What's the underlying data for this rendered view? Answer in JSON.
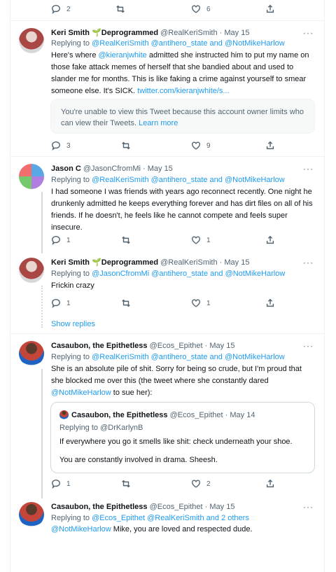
{
  "top_actions": {
    "reply": "2",
    "retweet": "",
    "like": "6"
  },
  "tweets": [
    {
      "name": "Keri Smith",
      "badge": "Deprogrammed",
      "handle": "@RealKeriSmith",
      "sep": " · ",
      "date": "May 15",
      "replying_prefix": "Replying to ",
      "replying_to": "@RealKeriSmith @antihero_state and @NotMikeHarlow",
      "body_1": "Here's where ",
      "body_mention": "@kieranjwhite",
      "body_2": " admitted she instructed him to put my name on those fake attack memes of herself that she bandied about and used to slander me for months. This is like faking a crime against yourself to smear someone else. It's SICK. ",
      "body_link": "twitter.com/kieranjwhite/s...",
      "card_text": "You're unable to view this Tweet because this account owner limits who can view their Tweets. ",
      "card_link": "Learn more",
      "reply_count": "3",
      "like_count": "9"
    },
    {
      "name": "Jason C",
      "handle": "@JasonCfromMi",
      "sep": " · ",
      "date": "May 15",
      "replying_prefix": "Replying to ",
      "replying_to": "@RealKeriSmith @antihero_state and @NotMikeHarlow",
      "body": "I had someone I was friends with years ago reconnect recently. One night he drunkenly admitted he keeps everything forever and has dirt files on all of his friends. If he doesn't, he feels like he cannot compete and feels super insecure.",
      "reply_count": "1",
      "like_count": "1"
    },
    {
      "name": "Keri Smith",
      "badge": "Deprogrammed",
      "handle": "@RealKeriSmith",
      "sep": " · ",
      "date": "May 15",
      "replying_prefix": "Replying to ",
      "replying_to": "@JasonCfromMi @antihero_state and @NotMikeHarlow",
      "body": "Frickin crazy",
      "reply_count": "1",
      "like_count": "1"
    },
    {
      "name": "Casaubon, the Epithetless",
      "handle": "@Ecos_Epithet",
      "sep": " · ",
      "date": "May 15",
      "replying_prefix": "Replying to ",
      "replying_to": "@RealKeriSmith @antihero_state and @NotMikeHarlow",
      "body_1": "She is an absolute pile of shit. Sorry for being so crude, but I'm proud that she blocked me over this (the tweet where she constantly dared ",
      "body_mention": "@NotMikeHarlow",
      "body_2": " to sue her):",
      "quote": {
        "name": "Casaubon, the Epithetless",
        "handle": "@Ecos_Epithet",
        "sep": " · ",
        "date": "May 14",
        "replying_prefix": "Replying to ",
        "replying_to": "@DrKarlynB",
        "line1": "If everywhere you go it smells like shit: check underneath your shoe.",
        "line2": "You are constantly involved in drama. Sheesh."
      },
      "reply_count": "1",
      "like_count": "2"
    },
    {
      "name": "Casaubon, the Epithetless",
      "handle": "@Ecos_Epithet",
      "sep": " · ",
      "date": "May 15",
      "replying_prefix": "Replying to ",
      "replying_to": "@Ecos_Epithet @RealKeriSmith and 2 others",
      "body_mention": "@NotMikeHarlow",
      "body_2": " Mike, you are loved and respected dude."
    }
  ],
  "show_replies": "Show replies",
  "more_glyph": "···"
}
